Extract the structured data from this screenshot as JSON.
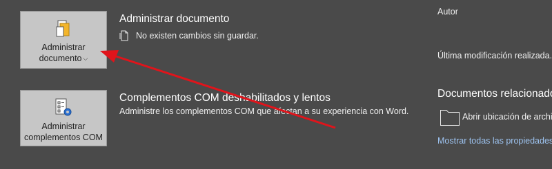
{
  "manage": {
    "button_line1": "Administrar",
    "button_line2": "documento",
    "title": "Administrar documento",
    "status": "No existen cambios sin guardar."
  },
  "com": {
    "button_line1": "Administrar",
    "button_line2": "complementos COM",
    "title": "Complementos COM deshabilitados y lentos",
    "desc": "Administre los complementos COM que afectan a su experiencia con Word."
  },
  "right": {
    "author_label": "Autor",
    "last_modified_label": "Última modificación realizada...",
    "related_title": "Documentos relacionados",
    "open_location": "Abrir ubicación de archivo",
    "show_all": "Mostrar todas las propiedades"
  },
  "colors": {
    "background": "#4a4a4a",
    "tile": "#c6c6c6",
    "arrow": "#e0141b",
    "link": "#9dc3f0"
  }
}
